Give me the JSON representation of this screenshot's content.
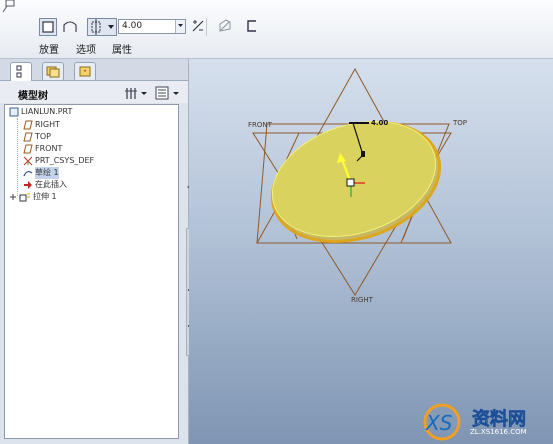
{
  "ribbon": {
    "placement_label": "放置",
    "options_label": "选项",
    "properties_label": "属性",
    "depth_value": "4.00"
  },
  "model_tree": {
    "title": "模型树",
    "items": [
      {
        "label": "LIANLUN.PRT",
        "icon": "part-icon"
      },
      {
        "label": "RIGHT",
        "icon": "datum-plane-icon"
      },
      {
        "label": "TOP",
        "icon": "datum-plane-icon"
      },
      {
        "label": "FRONT",
        "icon": "datum-plane-icon"
      },
      {
        "label": "PRT_CSYS_DEF",
        "icon": "csys-icon"
      },
      {
        "label": "草绘 1",
        "icon": "sketch-icon"
      },
      {
        "label": "在此插入",
        "icon": "insert-arrow-icon"
      },
      {
        "label": "拉伸 1",
        "icon": "extrude-icon"
      }
    ]
  },
  "viewport": {
    "plane_front": "FRONT",
    "plane_top": "TOP",
    "plane_right": "RIGHT",
    "dimension": "4.00"
  },
  "watermark": {
    "brand": "资料网",
    "site": "ZL.XS1616.COM"
  }
}
